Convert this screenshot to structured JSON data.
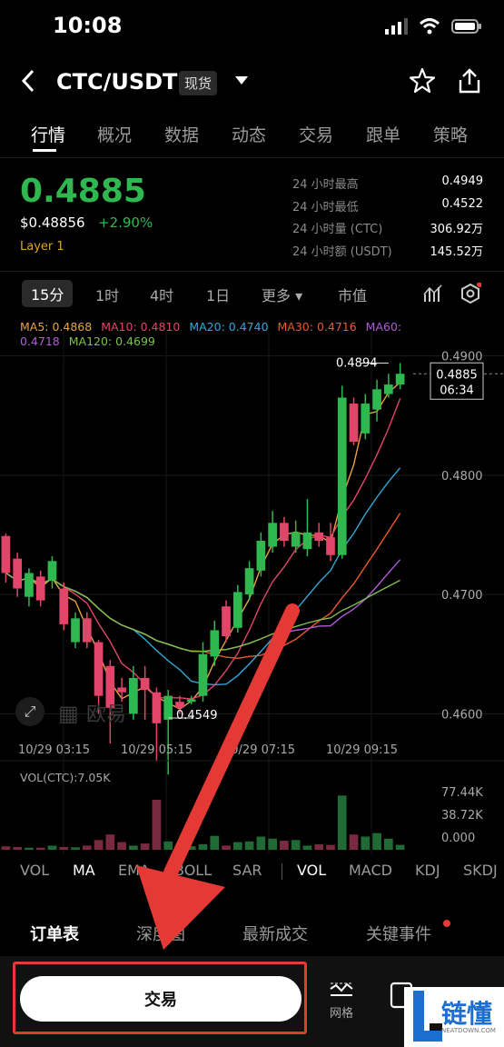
{
  "status": {
    "time": "10:08"
  },
  "header": {
    "pair": "CTC/USDT",
    "market_tag": "现货"
  },
  "tabs": [
    "行情",
    "概况",
    "数据",
    "动态",
    "交易",
    "跟单",
    "策略"
  ],
  "ticker": {
    "last_price": "0.4885",
    "usd_price": "$0.48856",
    "change": "+2.90%",
    "category": "Layer 1",
    "stats": [
      {
        "label": "24 小时最高",
        "value": "0.4949"
      },
      {
        "label": "24 小时最低",
        "value": "0.4522"
      },
      {
        "label": "24 小时量 (CTC)",
        "value": "306.92万"
      },
      {
        "label": "24 小时额 (USDT)",
        "value": "145.52万"
      }
    ]
  },
  "periods": [
    "15分",
    "1时",
    "4时",
    "1日",
    "更多 ▾",
    "市值"
  ],
  "ma": {
    "ma5": "MA5: 0.4868",
    "ma10": "MA10: 0.4810",
    "ma20": "MA20: 0.4740",
    "ma30": "MA30: 0.4716",
    "ma60": "MA60:",
    "ma60v": "0.4718",
    "ma120": "MA120: 0.4699"
  },
  "colors": {
    "up": "#2eb84f",
    "down": "#e0456a",
    "ma5": "#e8a33d",
    "ma10": "#e0456a",
    "ma20": "#2ea8d8",
    "ma30": "#e85a2a",
    "ma60": "#b05ad8",
    "ma120": "#7cc04a"
  },
  "chart_data": {
    "type": "candlestick",
    "y_ticks": [
      "0.4900",
      "0.4800",
      "0.4700",
      "0.4600"
    ],
    "x_labels": [
      "10/29 03:15",
      "10/29 05:15",
      "10/29 07:15",
      "10/29 09:15"
    ],
    "high_label": "0.4894",
    "low_label": "0.4549",
    "current_label": "0.4885",
    "countdown": "06:34",
    "watermark": "欧易",
    "ylim": [
      0.4585,
      0.4905
    ],
    "candles": [
      {
        "o": 0.4749,
        "c": 0.4718,
        "h": 0.4751,
        "l": 0.471
      },
      {
        "o": 0.473,
        "c": 0.4705,
        "h": 0.4735,
        "l": 0.4698
      },
      {
        "o": 0.4698,
        "c": 0.4718,
        "h": 0.4722,
        "l": 0.469
      },
      {
        "o": 0.4715,
        "c": 0.4695,
        "h": 0.472,
        "l": 0.469
      },
      {
        "o": 0.4712,
        "c": 0.4728,
        "h": 0.4732,
        "l": 0.4705
      },
      {
        "o": 0.4705,
        "c": 0.4675,
        "h": 0.471,
        "l": 0.467
      },
      {
        "o": 0.466,
        "c": 0.468,
        "h": 0.4685,
        "l": 0.4655
      },
      {
        "o": 0.468,
        "c": 0.466,
        "h": 0.4685,
        "l": 0.4655
      },
      {
        "o": 0.466,
        "c": 0.4615,
        "h": 0.4662,
        "l": 0.46
      },
      {
        "o": 0.464,
        "c": 0.4605,
        "h": 0.4645,
        "l": 0.4575
      },
      {
        "o": 0.4622,
        "c": 0.4618,
        "h": 0.463,
        "l": 0.461
      },
      {
        "o": 0.46,
        "c": 0.463,
        "h": 0.464,
        "l": 0.4595
      },
      {
        "o": 0.463,
        "c": 0.462,
        "h": 0.464,
        "l": 0.4595
      },
      {
        "o": 0.4618,
        "c": 0.4592,
        "h": 0.4622,
        "l": 0.456
      },
      {
        "o": 0.4595,
        "c": 0.4615,
        "h": 0.462,
        "l": 0.4549
      },
      {
        "o": 0.461,
        "c": 0.4605,
        "h": 0.4615,
        "l": 0.46
      },
      {
        "o": 0.461,
        "c": 0.4612,
        "h": 0.4615,
        "l": 0.4608
      },
      {
        "o": 0.4615,
        "c": 0.465,
        "h": 0.466,
        "l": 0.461
      },
      {
        "o": 0.4648,
        "c": 0.467,
        "h": 0.4678,
        "l": 0.464
      },
      {
        "o": 0.469,
        "c": 0.4665,
        "h": 0.4695,
        "l": 0.466
      },
      {
        "o": 0.4672,
        "c": 0.4702,
        "h": 0.4708,
        "l": 0.4668
      },
      {
        "o": 0.47,
        "c": 0.4722,
        "h": 0.4728,
        "l": 0.4695
      },
      {
        "o": 0.472,
        "c": 0.4745,
        "h": 0.4752,
        "l": 0.4715
      },
      {
        "o": 0.474,
        "c": 0.476,
        "h": 0.477,
        "l": 0.4735
      },
      {
        "o": 0.476,
        "c": 0.4745,
        "h": 0.4765,
        "l": 0.474
      },
      {
        "o": 0.474,
        "c": 0.4752,
        "h": 0.4762,
        "l": 0.4735
      },
      {
        "o": 0.4738,
        "c": 0.4752,
        "h": 0.478,
        "l": 0.4732
      },
      {
        "o": 0.4752,
        "c": 0.4745,
        "h": 0.476,
        "l": 0.474
      },
      {
        "o": 0.4748,
        "c": 0.4733,
        "h": 0.476,
        "l": 0.4728
      },
      {
        "o": 0.4733,
        "c": 0.4865,
        "h": 0.4875,
        "l": 0.473
      },
      {
        "o": 0.486,
        "c": 0.4828,
        "h": 0.4865,
        "l": 0.4825
      },
      {
        "o": 0.4835,
        "c": 0.486,
        "h": 0.4868,
        "l": 0.483
      },
      {
        "o": 0.4855,
        "c": 0.4872,
        "h": 0.488,
        "l": 0.4845
      },
      {
        "o": 0.4868,
        "c": 0.4876,
        "h": 0.4885,
        "l": 0.4865
      },
      {
        "o": 0.4876,
        "c": 0.4885,
        "h": 0.4894,
        "l": 0.4872
      }
    ],
    "volume": {
      "label": "VOL(CTC):7.05K",
      "ticks": [
        "77.44K",
        "38.72K",
        "0.000"
      ],
      "max": 85000,
      "values": [
        5000,
        4000,
        3000,
        3000,
        6000,
        4000,
        3500,
        6000,
        14000,
        22000,
        11000,
        6000,
        9000,
        72000,
        12000,
        5000,
        5000,
        8000,
        20000,
        6000,
        11000,
        12000,
        19000,
        16000,
        13000,
        14000,
        6000,
        8000,
        7000,
        78000,
        22000,
        19000,
        24000,
        16000,
        7050
      ]
    }
  },
  "indicators": [
    "VOL",
    "MA",
    "EMA",
    "BOLL",
    "SAR",
    "VOL",
    "MACD",
    "KDJ",
    "SKDJ"
  ],
  "bottom_tabs": [
    "订单表",
    "深度图",
    "最新成交",
    "关键事件"
  ],
  "footer": {
    "trade": "交易",
    "grid": "网格"
  },
  "watermark": {
    "brand": "链懂",
    "domain": "NEATDOWN.COM"
  }
}
